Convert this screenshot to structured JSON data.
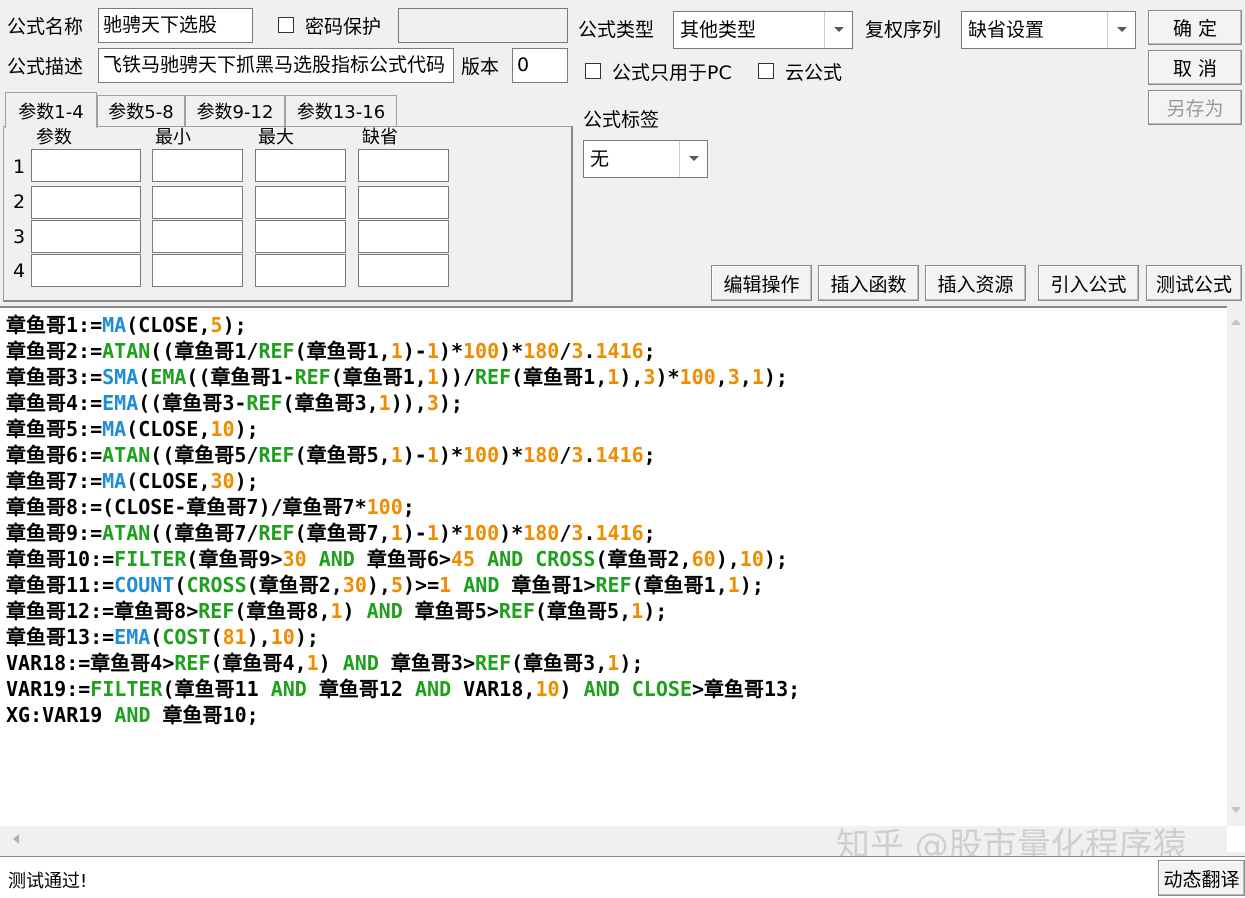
{
  "form": {
    "name_label": "公式名称",
    "name_value": "驰骋天下选股",
    "password_label": "密码保护",
    "desc_label": "公式描述",
    "desc_value": "飞铁马驰骋天下抓黑马选股指标公式代码",
    "version_label": "版本",
    "version_value": "0",
    "type_label": "公式类型",
    "type_value": "其他类型",
    "rights_label": "复权序列",
    "rights_value": "缺省设置",
    "pc_only_label": "公式只用于PC",
    "cloud_label": "云公式",
    "tag_label": "公式标签",
    "tag_value": "无"
  },
  "buttons": {
    "ok": "确  定",
    "cancel": "取  消",
    "save_as": "另存为",
    "edit_ops": "编辑操作",
    "insert_func": "插入函数",
    "insert_res": "插入资源",
    "import_formula": "引入公式",
    "test_formula": "测试公式",
    "dyn_translate": "动态翻译"
  },
  "tabs": [
    "参数1-4",
    "参数5-8",
    "参数9-12",
    "参数13-16"
  ],
  "params": {
    "headers": [
      "参数",
      "最小",
      "最大",
      "缺省"
    ],
    "rows": [
      "1",
      "2",
      "3",
      "4"
    ]
  },
  "code_lines": [
    [
      [
        "t",
        "章鱼哥1:="
      ],
      [
        "fn",
        "MA"
      ],
      [
        "t",
        "(CLOSE,"
      ],
      [
        "num",
        "5"
      ],
      [
        "t",
        ");"
      ]
    ],
    [
      [
        "t",
        "章鱼哥2:="
      ],
      [
        "kw",
        "ATAN"
      ],
      [
        "t",
        "((章鱼哥1/"
      ],
      [
        "kw",
        "REF"
      ],
      [
        "t",
        "(章鱼哥1,"
      ],
      [
        "num",
        "1"
      ],
      [
        "t",
        ")-"
      ],
      [
        "num",
        "1"
      ],
      [
        "t",
        ")*"
      ],
      [
        "num",
        "100"
      ],
      [
        "t",
        ")*"
      ],
      [
        "num",
        "180"
      ],
      [
        "t",
        "/"
      ],
      [
        "num",
        "3"
      ],
      [
        "t",
        "."
      ],
      [
        "num",
        "1416"
      ],
      [
        "t",
        ";"
      ]
    ],
    [
      [
        "t",
        "章鱼哥3:="
      ],
      [
        "fn",
        "SMA"
      ],
      [
        "t",
        "("
      ],
      [
        "kw",
        "EMA"
      ],
      [
        "t",
        "((章鱼哥1-"
      ],
      [
        "kw",
        "REF"
      ],
      [
        "t",
        "(章鱼哥1,"
      ],
      [
        "num",
        "1"
      ],
      [
        "t",
        "))/"
      ],
      [
        "kw",
        "REF"
      ],
      [
        "t",
        "(章鱼哥1,"
      ],
      [
        "num",
        "1"
      ],
      [
        "t",
        "),"
      ],
      [
        "num",
        "3"
      ],
      [
        "t",
        ")*"
      ],
      [
        "num",
        "100"
      ],
      [
        "t",
        ","
      ],
      [
        "num",
        "3"
      ],
      [
        "t",
        ","
      ],
      [
        "num",
        "1"
      ],
      [
        "t",
        ");"
      ]
    ],
    [
      [
        "t",
        "章鱼哥4:="
      ],
      [
        "fn",
        "EMA"
      ],
      [
        "t",
        "((章鱼哥3-"
      ],
      [
        "kw",
        "REF"
      ],
      [
        "t",
        "(章鱼哥3,"
      ],
      [
        "num",
        "1"
      ],
      [
        "t",
        ")),"
      ],
      [
        "num",
        "3"
      ],
      [
        "t",
        ");"
      ]
    ],
    [
      [
        "t",
        "章鱼哥5:="
      ],
      [
        "fn",
        "MA"
      ],
      [
        "t",
        "(CLOSE,"
      ],
      [
        "num",
        "10"
      ],
      [
        "t",
        ");"
      ]
    ],
    [
      [
        "t",
        "章鱼哥6:="
      ],
      [
        "kw",
        "ATAN"
      ],
      [
        "t",
        "((章鱼哥5/"
      ],
      [
        "kw",
        "REF"
      ],
      [
        "t",
        "(章鱼哥5,"
      ],
      [
        "num",
        "1"
      ],
      [
        "t",
        ")-"
      ],
      [
        "num",
        "1"
      ],
      [
        "t",
        ")*"
      ],
      [
        "num",
        "100"
      ],
      [
        "t",
        ")*"
      ],
      [
        "num",
        "180"
      ],
      [
        "t",
        "/"
      ],
      [
        "num",
        "3"
      ],
      [
        "t",
        "."
      ],
      [
        "num",
        "1416"
      ],
      [
        "t",
        ";"
      ]
    ],
    [
      [
        "t",
        "章鱼哥7:="
      ],
      [
        "fn",
        "MA"
      ],
      [
        "t",
        "(CLOSE,"
      ],
      [
        "num",
        "30"
      ],
      [
        "t",
        ");"
      ]
    ],
    [
      [
        "t",
        "章鱼哥8:=(CLOSE-章鱼哥7)/章鱼哥7*"
      ],
      [
        "num",
        "100"
      ],
      [
        "t",
        ";"
      ]
    ],
    [
      [
        "t",
        "章鱼哥9:="
      ],
      [
        "kw",
        "ATAN"
      ],
      [
        "t",
        "((章鱼哥7/"
      ],
      [
        "kw",
        "REF"
      ],
      [
        "t",
        "(章鱼哥7,"
      ],
      [
        "num",
        "1"
      ],
      [
        "t",
        ")-"
      ],
      [
        "num",
        "1"
      ],
      [
        "t",
        ")*"
      ],
      [
        "num",
        "100"
      ],
      [
        "t",
        ")*"
      ],
      [
        "num",
        "180"
      ],
      [
        "t",
        "/"
      ],
      [
        "num",
        "3"
      ],
      [
        "t",
        "."
      ],
      [
        "num",
        "1416"
      ],
      [
        "t",
        ";"
      ]
    ],
    [
      [
        "t",
        "章鱼哥10:="
      ],
      [
        "kw",
        "FILTER"
      ],
      [
        "t",
        "(章鱼哥9>"
      ],
      [
        "num",
        "30"
      ],
      [
        "t",
        " "
      ],
      [
        "kw",
        "AND"
      ],
      [
        "t",
        " 章鱼哥6>"
      ],
      [
        "num",
        "45"
      ],
      [
        "t",
        " "
      ],
      [
        "kw",
        "AND"
      ],
      [
        "t",
        " "
      ],
      [
        "kw",
        "CROSS"
      ],
      [
        "t",
        "(章鱼哥2,"
      ],
      [
        "num",
        "60"
      ],
      [
        "t",
        "),"
      ],
      [
        "num",
        "10"
      ],
      [
        "t",
        ");"
      ]
    ],
    [
      [
        "t",
        "章鱼哥11:="
      ],
      [
        "fn",
        "COUNT"
      ],
      [
        "t",
        "("
      ],
      [
        "kw",
        "CROSS"
      ],
      [
        "t",
        "(章鱼哥2,"
      ],
      [
        "num",
        "30"
      ],
      [
        "t",
        "),"
      ],
      [
        "num",
        "5"
      ],
      [
        "t",
        ")>="
      ],
      [
        "num",
        "1"
      ],
      [
        "t",
        " "
      ],
      [
        "kw",
        "AND"
      ],
      [
        "t",
        " 章鱼哥1>"
      ],
      [
        "kw",
        "REF"
      ],
      [
        "t",
        "(章鱼哥1,"
      ],
      [
        "num",
        "1"
      ],
      [
        "t",
        ");"
      ]
    ],
    [
      [
        "t",
        "章鱼哥12:=章鱼哥8>"
      ],
      [
        "kw",
        "REF"
      ],
      [
        "t",
        "(章鱼哥8,"
      ],
      [
        "num",
        "1"
      ],
      [
        "t",
        ") "
      ],
      [
        "kw",
        "AND"
      ],
      [
        "t",
        " 章鱼哥5>"
      ],
      [
        "kw",
        "REF"
      ],
      [
        "t",
        "(章鱼哥5,"
      ],
      [
        "num",
        "1"
      ],
      [
        "t",
        ");"
      ]
    ],
    [
      [
        "t",
        "章鱼哥13:="
      ],
      [
        "fn",
        "EMA"
      ],
      [
        "t",
        "("
      ],
      [
        "kw",
        "COST"
      ],
      [
        "t",
        "("
      ],
      [
        "num",
        "81"
      ],
      [
        "t",
        "),"
      ],
      [
        "num",
        "10"
      ],
      [
        "t",
        ");"
      ]
    ],
    [
      [
        "t",
        "VAR18:=章鱼哥4>"
      ],
      [
        "kw",
        "REF"
      ],
      [
        "t",
        "(章鱼哥4,"
      ],
      [
        "num",
        "1"
      ],
      [
        "t",
        ") "
      ],
      [
        "kw",
        "AND"
      ],
      [
        "t",
        " 章鱼哥3>"
      ],
      [
        "kw",
        "REF"
      ],
      [
        "t",
        "(章鱼哥3,"
      ],
      [
        "num",
        "1"
      ],
      [
        "t",
        ");"
      ]
    ],
    [
      [
        "t",
        "VAR19:="
      ],
      [
        "kw",
        "FILTER"
      ],
      [
        "t",
        "(章鱼哥11 "
      ],
      [
        "kw",
        "AND"
      ],
      [
        "t",
        " 章鱼哥12 "
      ],
      [
        "kw",
        "AND"
      ],
      [
        "t",
        " VAR18,"
      ],
      [
        "num",
        "10"
      ],
      [
        "t",
        ") "
      ],
      [
        "kw",
        "AND"
      ],
      [
        "t",
        " "
      ],
      [
        "kw",
        "CLOSE"
      ],
      [
        "t",
        ">章鱼哥13;"
      ]
    ],
    [
      [
        "t",
        "XG:VAR19 "
      ],
      [
        "kw",
        "AND"
      ],
      [
        "t",
        " 章鱼哥10;"
      ]
    ]
  ],
  "status": {
    "message": "测试通过!"
  },
  "watermark": "知乎 @股市量化程序猿",
  "colors": {
    "function": "#1e8cd6",
    "keyword": "#1ea01e",
    "number": "#f08c00"
  }
}
